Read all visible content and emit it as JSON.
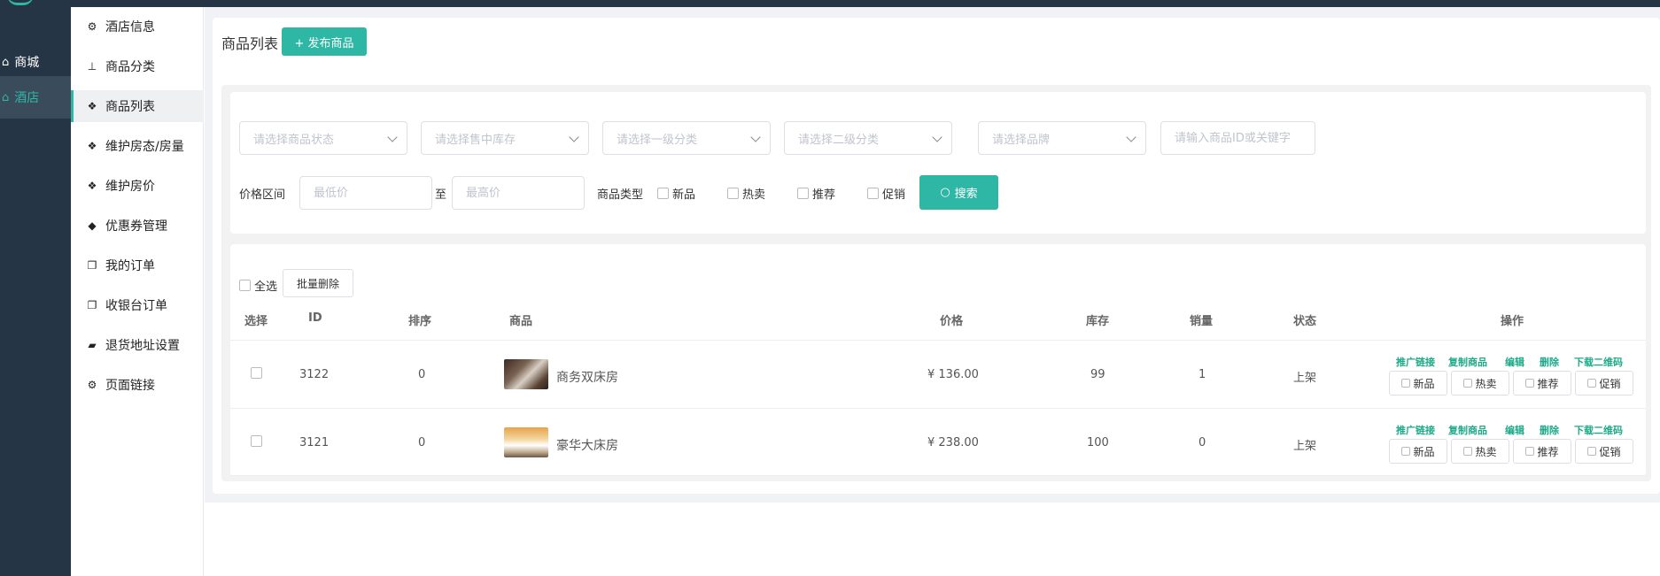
{
  "rail": {
    "items": [
      {
        "icon": "home-icon",
        "label": "商城",
        "active": false
      },
      {
        "icon": "home-icon",
        "label": "酒店",
        "active": true
      }
    ]
  },
  "subnav": {
    "items": [
      {
        "icon": "gears-icon",
        "label": "酒店信息"
      },
      {
        "icon": "sitemap-icon",
        "label": "商品分类"
      },
      {
        "icon": "cubes-icon",
        "label": "商品列表",
        "active": true
      },
      {
        "icon": "cubes-icon",
        "label": "维护房态/房量"
      },
      {
        "icon": "cubes-icon",
        "label": "维护房价"
      },
      {
        "icon": "tags-icon",
        "label": "优惠券管理"
      },
      {
        "icon": "copy-icon",
        "label": "我的订单"
      },
      {
        "icon": "copy-icon",
        "label": "收银台订单"
      },
      {
        "icon": "truck-icon",
        "label": "退货地址设置"
      },
      {
        "icon": "gears-icon",
        "label": "页面链接"
      }
    ]
  },
  "page": {
    "title": "商品列表",
    "publish_button": "+ 发布商品"
  },
  "filters": {
    "status_placeholder": "请选择商品状态",
    "stock_placeholder": "请选择售中库存",
    "cat1_placeholder": "请选择一级分类",
    "cat2_placeholder": "请选择二级分类",
    "brand_placeholder": "请选择品牌",
    "keyword_placeholder": "请输入商品ID或关键字",
    "price_label": "价格区间",
    "min_placeholder": "最低价",
    "to_label": "至",
    "max_placeholder": "最高价",
    "type_label": "商品类型",
    "types": [
      "新品",
      "热卖",
      "推荐",
      "促销"
    ],
    "search_button": "搜索"
  },
  "list": {
    "select_all": "全选",
    "batch_delete": "批量删除",
    "columns": [
      "选择",
      "ID",
      "排序",
      "商品",
      "价格",
      "库存",
      "销量",
      "状态",
      "操作"
    ],
    "rows": [
      {
        "id": "3122",
        "sort": "0",
        "name": "商务双床房",
        "price": "¥ 136.00",
        "stock": "99",
        "sales": "1",
        "status": "上架"
      },
      {
        "id": "3121",
        "sort": "0",
        "name": "豪华大床房",
        "price": "¥ 238.00",
        "stock": "100",
        "sales": "0",
        "status": "上架"
      }
    ],
    "op_links": [
      "推广链接",
      "复制商品",
      "编辑",
      "删除",
      "下载二维码"
    ],
    "op_buttons": [
      "新品",
      "热卖",
      "推荐",
      "促销"
    ]
  },
  "colors": {
    "accent": "#2fb7a6",
    "sidebar_bg": "#263545",
    "link": "#1eaa88"
  }
}
